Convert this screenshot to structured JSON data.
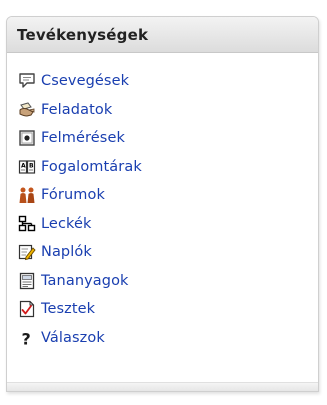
{
  "block": {
    "title": "Tevékenységek",
    "items": [
      {
        "label": "Csevegések",
        "icon": "chat-bubble-icon"
      },
      {
        "label": "Feladatok",
        "icon": "assignment-hand-icon"
      },
      {
        "label": "Felmérések",
        "icon": "survey-icon"
      },
      {
        "label": "Fogalomtárak",
        "icon": "glossary-book-icon"
      },
      {
        "label": "Fórumok",
        "icon": "forum-people-icon"
      },
      {
        "label": "Leckék",
        "icon": "lesson-tree-icon"
      },
      {
        "label": "Naplók",
        "icon": "journal-pencil-icon"
      },
      {
        "label": "Tananyagok",
        "icon": "resource-document-icon"
      },
      {
        "label": "Tesztek",
        "icon": "quiz-check-icon"
      },
      {
        "label": "Válaszok",
        "icon": "question-mark-icon"
      }
    ]
  },
  "colors": {
    "link": "#1a3fb0",
    "header_bg": "#e4e4e4"
  }
}
